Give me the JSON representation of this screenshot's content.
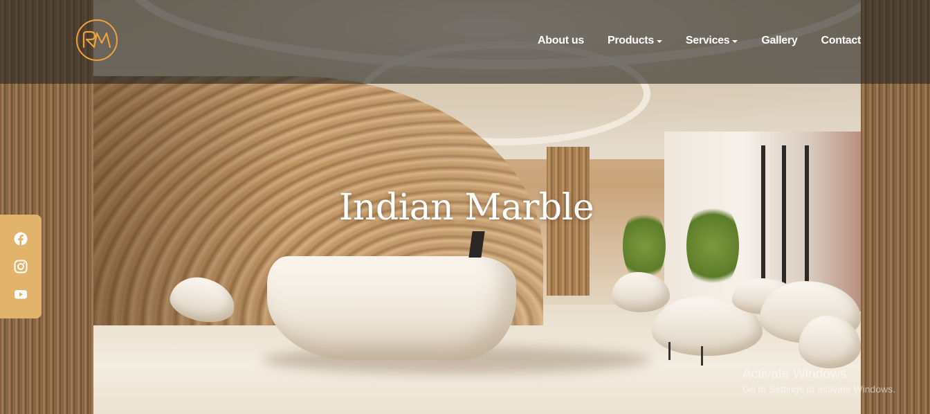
{
  "brand": {
    "logo_text": "RM",
    "accent_color": "#f0a13a"
  },
  "nav": {
    "items": [
      {
        "label": "About us",
        "has_dropdown": false
      },
      {
        "label": "Products",
        "has_dropdown": true
      },
      {
        "label": "Services",
        "has_dropdown": true
      },
      {
        "label": "Gallery",
        "has_dropdown": false
      },
      {
        "label": "Contact",
        "has_dropdown": false
      }
    ]
  },
  "hero": {
    "title": "Indian Marble"
  },
  "social": {
    "background_color": "#e2b36b",
    "icons": [
      "facebook-icon",
      "instagram-icon",
      "youtube-icon"
    ]
  },
  "watermark": {
    "title": "Activate Windows",
    "subtitle": "Go to Settings to activate Windows."
  }
}
